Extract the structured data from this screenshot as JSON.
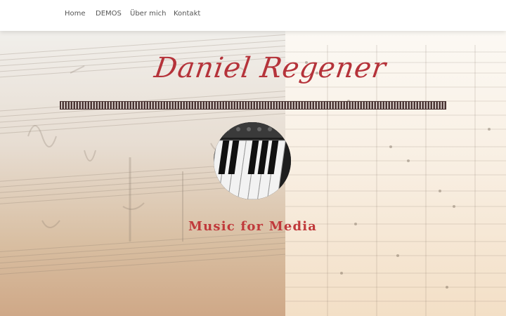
{
  "nav": {
    "items": [
      {
        "label": "Home"
      },
      {
        "label": "DEMOS"
      },
      {
        "label": "Über mich"
      },
      {
        "label": "Kontakt"
      }
    ]
  },
  "hero": {
    "title": "Daniel Regener",
    "tagline": "Music for Media"
  },
  "colors": {
    "accent": "#c0393b",
    "nav_text": "#555555"
  }
}
